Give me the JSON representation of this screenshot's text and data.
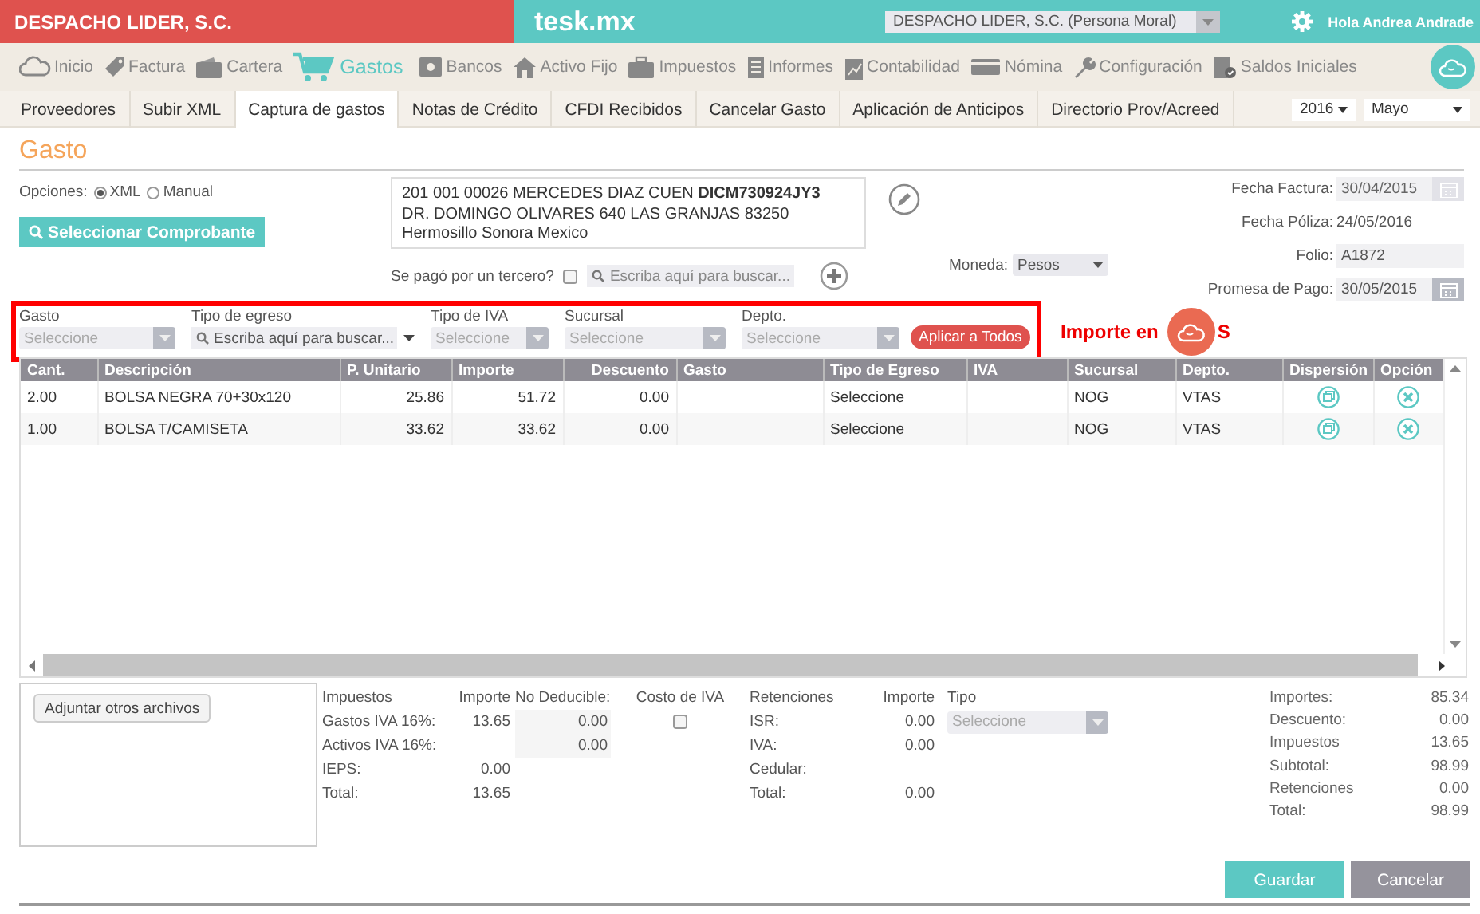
{
  "header": {
    "company": "DESPACHO LIDER, S.C.",
    "app_name": "tesk.mx",
    "company_select": "DESPACHO LIDER, S.C. (Persona Moral)",
    "greeting": "Hola Andrea Andrade"
  },
  "main_nav": [
    {
      "label": "Inicio",
      "selected": false
    },
    {
      "label": "Factura",
      "selected": false
    },
    {
      "label": "Cartera",
      "selected": false
    },
    {
      "label": "Gastos",
      "selected": true
    },
    {
      "label": "Bancos",
      "selected": false
    },
    {
      "label": "Activo Fijo",
      "selected": false
    },
    {
      "label": "Impuestos",
      "selected": false
    },
    {
      "label": "Informes",
      "selected": false
    },
    {
      "label": "Contabilidad",
      "selected": false
    },
    {
      "label": "Nómina",
      "selected": false
    },
    {
      "label": "Configuración",
      "selected": false
    },
    {
      "label": "Saldos Iniciales",
      "selected": false
    }
  ],
  "sub_tabs": [
    {
      "label": "Proveedores",
      "selected": false
    },
    {
      "label": "Subir XML",
      "selected": false
    },
    {
      "label": "Captura de gastos",
      "selected": true
    },
    {
      "label": "Notas de Crédito",
      "selected": false
    },
    {
      "label": "CFDI Recibidos",
      "selected": false
    },
    {
      "label": "Cancelar Gasto",
      "selected": false
    },
    {
      "label": "Aplicación de Anticipos",
      "selected": false
    },
    {
      "label": "Directorio Prov/Acreed",
      "selected": false
    }
  ],
  "period": {
    "year": "2016",
    "month": "Mayo"
  },
  "form": {
    "title": "Gasto",
    "options_label": "Opciones:",
    "options": [
      {
        "label": "XML",
        "selected": true
      },
      {
        "label": "Manual",
        "selected": false
      }
    ],
    "select_button": "Seleccionar Comprobante",
    "supplier_lines": [
      "201 001 00026 MERCEDES DIAZ CUEN **DICM730924JY3**",
      "DR. DOMINGO OLIVARES 640 LAS GRANJAS 83250",
      "Hermosillo Sonora Mexico"
    ],
    "third_party": {
      "label": "Se pagó por un tercero?",
      "checked": false,
      "placeholder": "Escriba aquí para buscar..."
    },
    "currency": {
      "label": "Moneda:",
      "value": "Pesos"
    },
    "dates": [
      {
        "label": "Fecha Factura:",
        "value": "30/04/2015",
        "kind": "date"
      },
      {
        "label": "Fecha Póliza:",
        "value": "24/05/2016",
        "kind": "text"
      },
      {
        "label": "Folio:",
        "value": "A1872",
        "kind": "input"
      },
      {
        "label": "Promesa de Pago:",
        "value": "30/05/2015",
        "kind": "date"
      }
    ]
  },
  "bulk_filters": {
    "fields": [
      {
        "label": "Gasto",
        "kind": "select",
        "placeholder": "Seleccione"
      },
      {
        "label": "Tipo de egreso",
        "kind": "search",
        "placeholder": "Escriba aquí para buscar..."
      },
      {
        "label": "Tipo de IVA",
        "kind": "select",
        "placeholder": "Seleccione"
      },
      {
        "label": "Sucursal",
        "kind": "select",
        "placeholder": "Seleccione"
      },
      {
        "label": "Depto.",
        "kind": "select",
        "placeholder": "Seleccione"
      }
    ],
    "apply_button": "Aplicar a Todos"
  },
  "import_note": [
    "Importe en",
    "S"
  ],
  "table": {
    "columns": [
      "Cant.",
      "Descripción",
      "P. Unitario",
      "Importe",
      "Descuento",
      "Gasto",
      "Tipo de Egreso",
      "IVA",
      "Sucursal",
      "Depto.",
      "Dispersión",
      "Opción"
    ],
    "rows": [
      {
        "cant": "2.00",
        "descripcion": "BOLSA NEGRA 70+30x120",
        "p_unitario": "25.86",
        "importe": "51.72",
        "descuento": "0.00",
        "tipo_egreso": "Seleccione",
        "sucursal": "NOG",
        "depto": "VTAS"
      },
      {
        "cant": "1.00",
        "descripcion": "BOLSA T/CAMISETA",
        "p_unitario": "33.62",
        "importe": "33.62",
        "descuento": "0.00",
        "tipo_egreso": "Seleccione",
        "sucursal": "NOG",
        "depto": "VTAS"
      }
    ]
  },
  "attach_button": "Adjuntar otros archivos",
  "taxes": {
    "headers": [
      "Impuestos",
      "Importe",
      "No Deducible:",
      "Costo de IVA"
    ],
    "rows": [
      {
        "label": "Gastos IVA 16%:",
        "amount": "13.65",
        "non_deductible": "0.00"
      },
      {
        "label": "Activos IVA 16%:",
        "non_deductible": "0.00"
      },
      {
        "label": "IEPS:",
        "amount": "0.00"
      },
      {
        "label": "Total:",
        "amount": "13.65"
      }
    ],
    "iva_cost_checked": false
  },
  "retentions": {
    "headers": [
      "Retenciones",
      "Importe",
      "Tipo"
    ],
    "rows": [
      {
        "label": "ISR:",
        "amount": "0.00"
      },
      {
        "label": "IVA:",
        "amount": "0.00"
      },
      {
        "label": "Cedular:"
      },
      {
        "label": "Total:",
        "amount": "0.00"
      }
    ],
    "type_placeholder": "Seleccione"
  },
  "summary": [
    {
      "label": "Importes:",
      "value": "85.34"
    },
    {
      "label": "Descuento:",
      "value": "0.00"
    },
    {
      "label": "Impuestos",
      "value": "13.65"
    },
    {
      "label": "Subtotal:",
      "value": "98.99"
    },
    {
      "label": "Retenciones",
      "value": "0.00"
    },
    {
      "label": "Total:",
      "value": "98.99"
    }
  ],
  "buttons": [
    "Guardar",
    "Cancelar"
  ]
}
